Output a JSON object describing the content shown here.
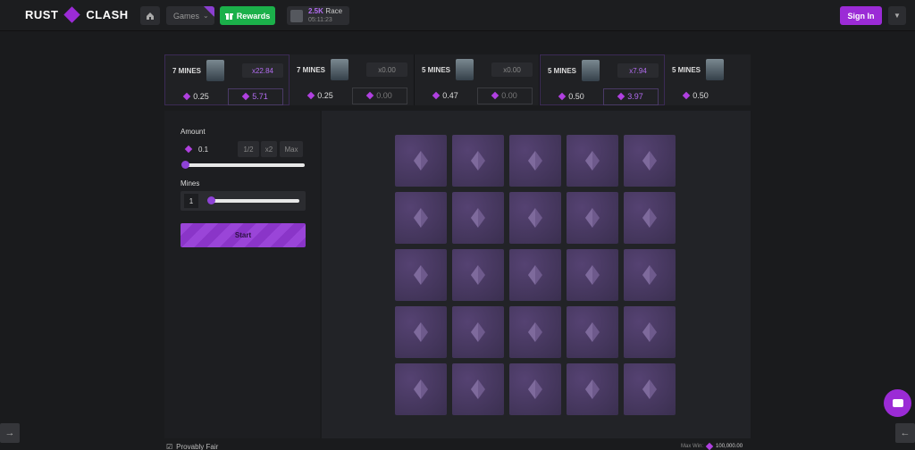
{
  "brand": {
    "left": "RUST",
    "right": "CLASH"
  },
  "nav": {
    "games_label": "Games",
    "rewards_label": "Rewards",
    "race_amount": "2.5K",
    "race_label": "Race",
    "race_timer": "05:11:23",
    "signin_label": "Sign In"
  },
  "recent_games": [
    {
      "mines": "7 MINES",
      "multiplier": "x22.84",
      "bet": "0.25",
      "payout": "5.71"
    },
    {
      "mines": "7 MINES",
      "multiplier": "x0.00",
      "bet": "0.25",
      "payout": "0.00"
    },
    {
      "mines": "5 MINES",
      "multiplier": "x0.00",
      "bet": "0.47",
      "payout": "0.00"
    },
    {
      "mines": "5 MINES",
      "multiplier": "x7.94",
      "bet": "0.50",
      "payout": "3.97"
    },
    {
      "mines": "5 MINES",
      "multiplier": "",
      "bet": "0.50",
      "payout": ""
    }
  ],
  "controls": {
    "amount_label": "Amount",
    "amount_value": "0.1",
    "half_label": "1/2",
    "double_label": "x2",
    "max_label": "Max",
    "mines_label": "Mines",
    "mines_value": "1",
    "start_label": "Start"
  },
  "footer": {
    "provably_fair": "Provably Fair",
    "max_win_label": "Max Win:",
    "max_win_value": "100,000.00"
  },
  "colors": {
    "accent": "#9b2bd6",
    "rewards": "#1bb04a",
    "tile": "#46385e"
  },
  "icons": [
    "home-icon",
    "gift-icon",
    "flag-icon",
    "chevron-down-icon",
    "gem-icon",
    "chat-icon",
    "arrow-right-icon",
    "arrow-left-icon",
    "check-icon"
  ]
}
